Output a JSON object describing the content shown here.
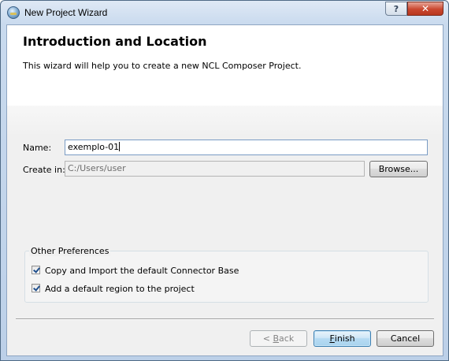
{
  "window": {
    "title": "New Project Wizard",
    "help_glyph": "?",
    "close_glyph": "✕"
  },
  "header": {
    "title": "Introduction and Location",
    "subtitle": "This wizard will help you to create a new NCL Composer Project."
  },
  "form": {
    "name_label": "Name:",
    "name_value": "exemplo-01",
    "create_in_label": "Create in:",
    "create_in_value": "C:/Users/user",
    "browse_label": "Browse..."
  },
  "preferences": {
    "title": "Other Preferences",
    "options": [
      {
        "label": "Copy and Import the default Connector Base",
        "checked": true
      },
      {
        "label": "Add a default region to the project",
        "checked": true
      }
    ]
  },
  "footer": {
    "back_prefix": "< ",
    "back_mnemonic": "B",
    "back_rest": "ack",
    "finish_mnemonic": "F",
    "finish_rest": "inish",
    "cancel_label": "Cancel"
  }
}
